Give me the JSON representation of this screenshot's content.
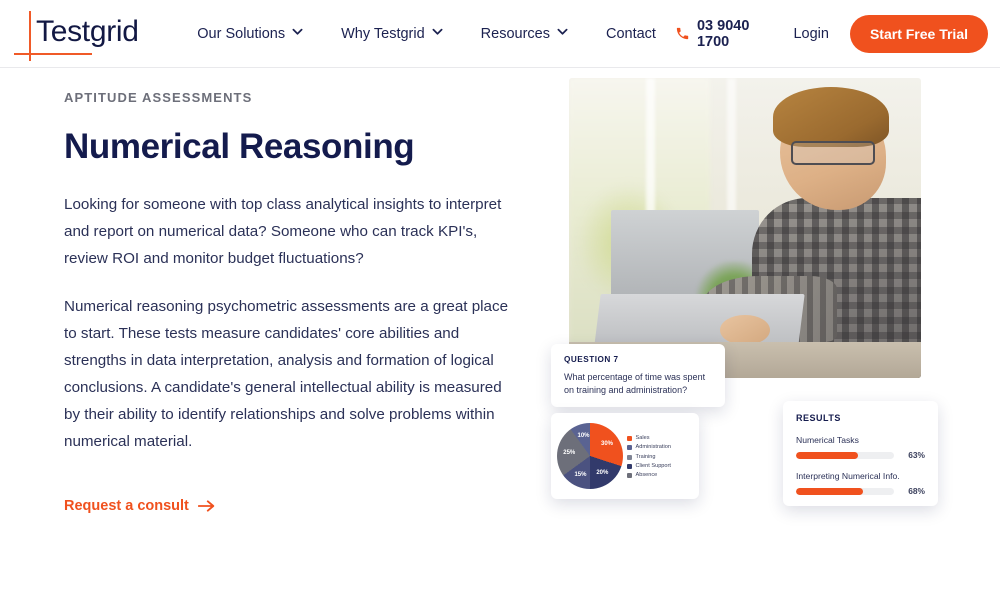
{
  "brand": {
    "name": "Testgrid",
    "accent": "#f0511e",
    "navy": "#141b4d"
  },
  "header": {
    "nav": [
      {
        "label": "Our Solutions",
        "has_caret": true
      },
      {
        "label": "Why Testgrid",
        "has_caret": true
      },
      {
        "label": "Resources",
        "has_caret": true
      },
      {
        "label": "Contact",
        "has_caret": false
      }
    ],
    "phone": "03 9040 1700",
    "phone_icon": "phone-icon",
    "login_label": "Login",
    "cta_label": "Start Free Trial"
  },
  "hero": {
    "eyebrow": "APTITUDE ASSESSMENTS",
    "title": "Numerical Reasoning",
    "paragraph_1": "Looking for someone with top class analytical insights to interpret and report on numerical data? Someone who can track KPI's, review ROI and monitor budget fluctuations?",
    "paragraph_2": "Numerical reasoning psychometric assessments are a great place to start. These tests measure candidates' core abilities and strengths in data interpretation, analysis and formation of logical conclusions. A candidate's general intellectual ability is measured by their ability to identify relationships and solve problems within numerical material.",
    "cta_link_label": "Request a consult",
    "cta_link_icon": "arrow-right-icon"
  },
  "question_card": {
    "label": "QUESTION 7",
    "text": "What percentage of time was spent on training and administration?"
  },
  "results_card": {
    "label": "RESULTS",
    "rows": [
      {
        "name": "Numerical Tasks",
        "percent": "63%",
        "value": 63
      },
      {
        "name": "Interpreting Numerical Info.",
        "percent": "68%",
        "value": 68
      }
    ],
    "bar_color": "#f0511e",
    "track_color": "#eeeff1"
  },
  "chart_data": {
    "type": "pie",
    "title": "",
    "legend_position": "right",
    "categories": [
      "Sales",
      "Administration",
      "Training",
      "Client Support",
      "Absence"
    ],
    "values": [
      30,
      10,
      25,
      15,
      20
    ],
    "labels": [
      "30%",
      "10%",
      "25%",
      "15%",
      "20%"
    ],
    "colors": [
      "#f0511e",
      "#5a6392",
      "#7f8494",
      "#323a6b",
      "#6d6f7a"
    ],
    "slice_order_clockwise_from_top": [
      {
        "name": "Sales",
        "value": 30,
        "label": "30%",
        "color": "#f0511e"
      },
      {
        "name": "Client Support",
        "value": 20,
        "label": "20%",
        "color": "#323a6b"
      },
      {
        "name": "Training",
        "value": 15,
        "label": "15%",
        "color": "#4b5280"
      },
      {
        "name": "Absence",
        "value": 25,
        "label": "25%",
        "color": "#6d6f7a"
      },
      {
        "name": "Administration",
        "value": 10,
        "label": "10%",
        "color": "#5a6392"
      }
    ]
  }
}
